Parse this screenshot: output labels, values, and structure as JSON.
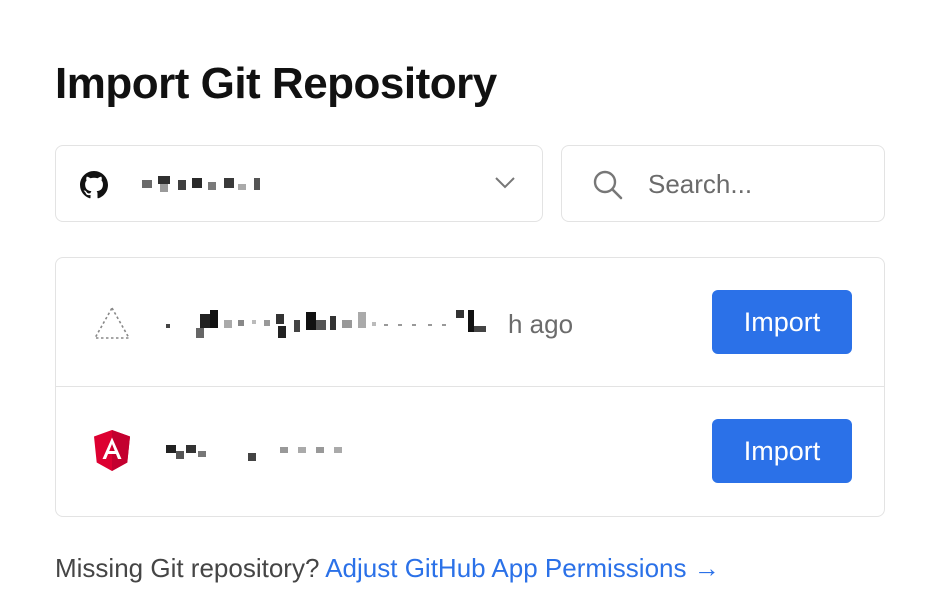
{
  "page": {
    "title": "Import Git Repository"
  },
  "account_selector": {
    "icon": "github-icon",
    "account_name": "",
    "chevron_icon": "chevron-down-icon"
  },
  "search": {
    "placeholder": "Search...",
    "value": ""
  },
  "repositories": [
    {
      "icon": "vercel-triangle-icon",
      "name": "",
      "time_ago": "h ago",
      "action_label": "Import"
    },
    {
      "icon": "angular-icon",
      "name": "",
      "action_label": "Import"
    }
  ],
  "footer": {
    "prompt_text": "Missing Git repository?",
    "link_text": "Adjust GitHub App Permissions →"
  },
  "colors": {
    "accent": "#2b71e8",
    "border": "#e3e3e3",
    "muted_text": "#6b6b6b",
    "angular_red": "#dd0031"
  }
}
